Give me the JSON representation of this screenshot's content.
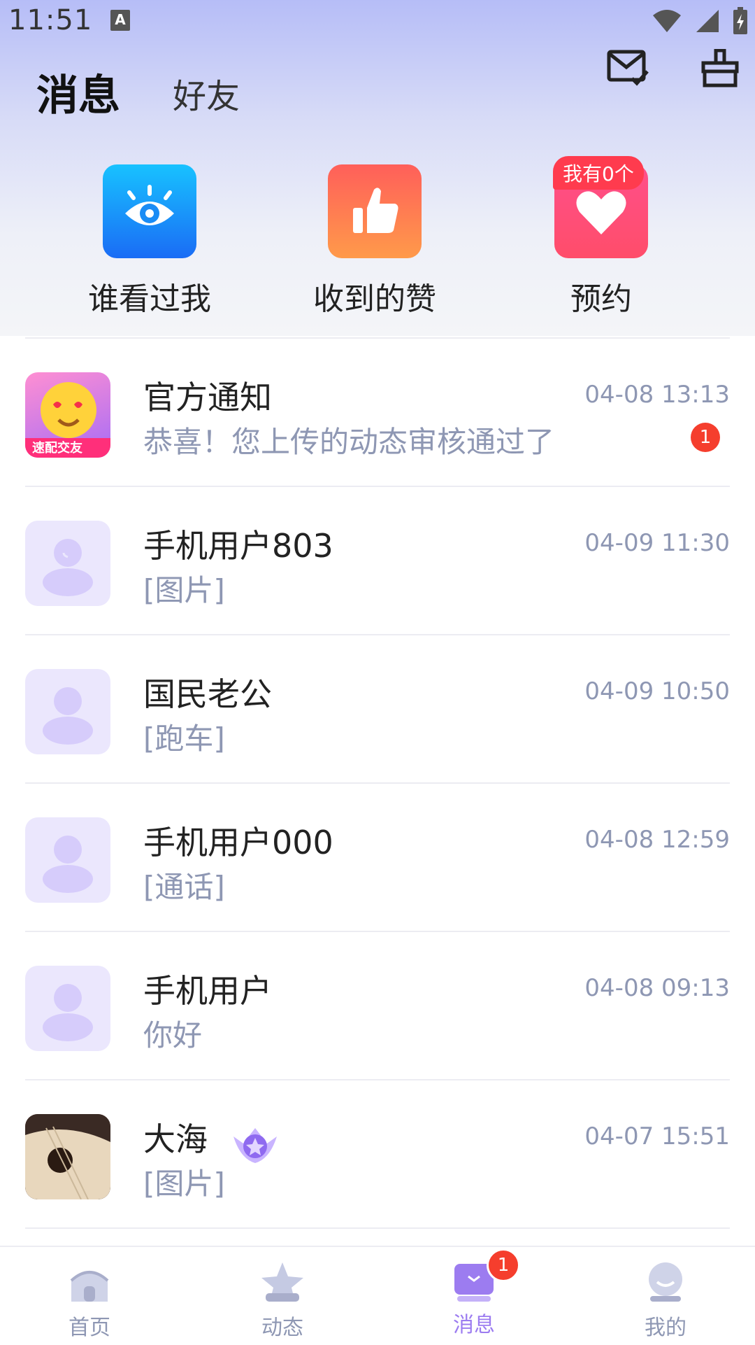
{
  "status_bar": {
    "time": "11:51",
    "indicator": "A"
  },
  "header": {
    "tabs": [
      {
        "label": "消息",
        "active": true
      },
      {
        "label": "好友",
        "active": false
      }
    ],
    "icons": [
      "mail-check-icon",
      "broom-icon"
    ]
  },
  "quick_actions": [
    {
      "label": "谁看过我",
      "icon": "eye-icon",
      "color": "#1f8ff5"
    },
    {
      "label": "收到的赞",
      "icon": "thumbs-up-icon",
      "color": "#ff7a4d"
    },
    {
      "label": "预约",
      "icon": "heart-icon",
      "color": "#ff4d7d",
      "badge": "我有0个"
    }
  ],
  "messages": [
    {
      "name": "官方通知",
      "preview": "恭喜！您上传的动态审核通过了",
      "time": "04-08 13:13",
      "unread": "1",
      "avatar": "app-logo",
      "avatar_caption": "速配交友"
    },
    {
      "name": "手机用户803",
      "preview": "[图片]",
      "time": "04-09 11:30",
      "avatar": "default-user"
    },
    {
      "name": "国民老公",
      "preview": "[跑车]",
      "time": "04-09 10:50",
      "avatar": "default-user"
    },
    {
      "name": "手机用户000",
      "preview": "[通话]",
      "time": "04-08 12:59",
      "avatar": "default-user"
    },
    {
      "name": "手机用户",
      "preview": "你好",
      "time": "04-08 09:13",
      "avatar": "default-user"
    },
    {
      "name": "大海",
      "preview": "[图片]",
      "time": "04-07 15:51",
      "avatar": "guitar-photo",
      "vip": true
    }
  ],
  "bottom_nav": [
    {
      "label": "首页",
      "icon": "home-icon",
      "active": false
    },
    {
      "label": "动态",
      "icon": "star-icon",
      "active": false
    },
    {
      "label": "消息",
      "icon": "message-icon",
      "active": true,
      "badge": "1"
    },
    {
      "label": "我的",
      "icon": "profile-icon",
      "active": false
    }
  ],
  "colors": {
    "accent": "#9c7cf0",
    "badge": "#f53e2d",
    "muted": "#8e97b3"
  }
}
